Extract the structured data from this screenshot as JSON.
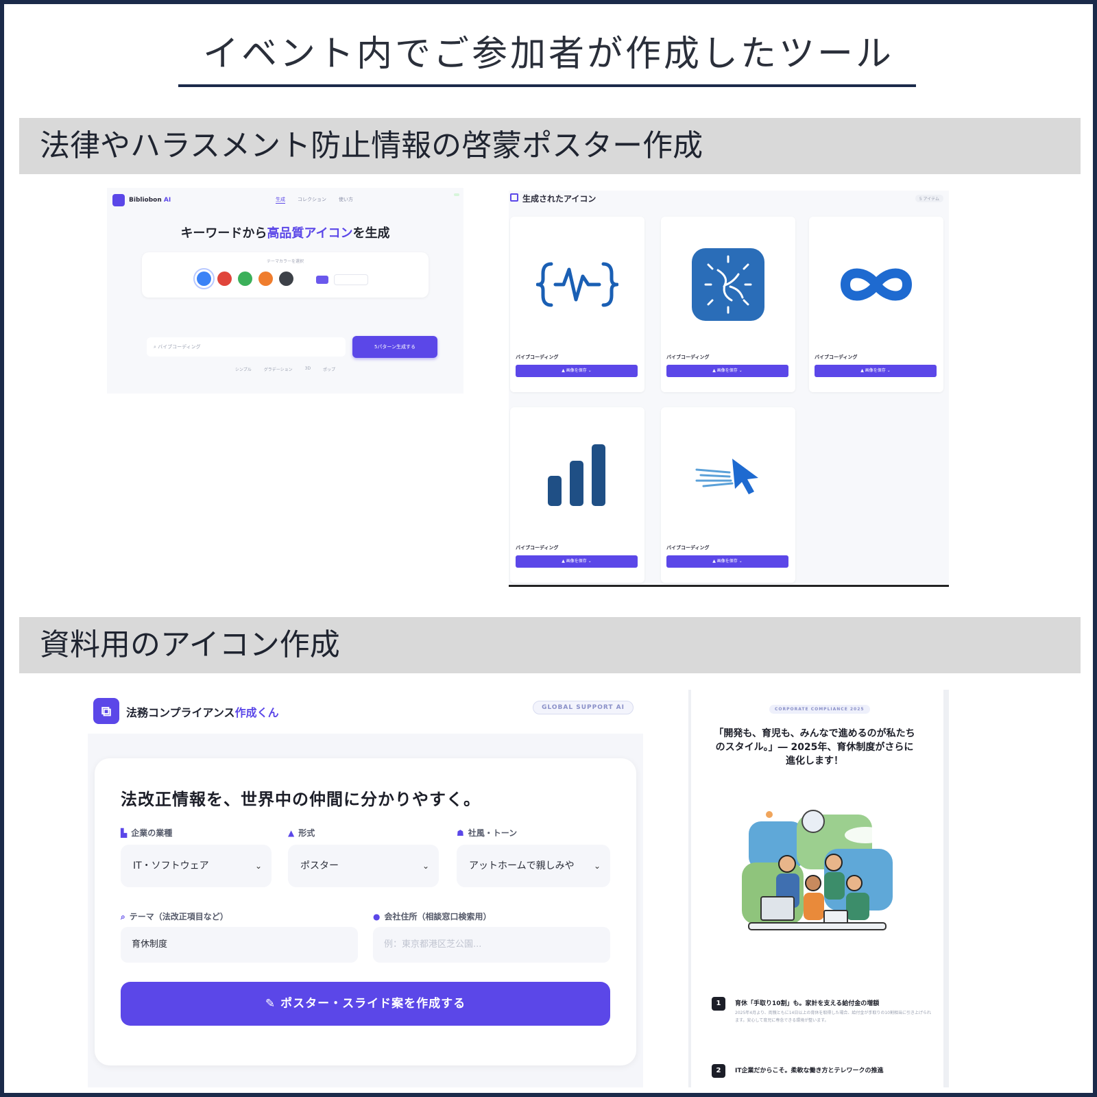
{
  "page": {
    "title": "イベント内でご参加者が作成したツール",
    "section1": "法律やハラスメント防止情報の啓蒙ポスター作成",
    "section2": "資料用のアイコン作成"
  },
  "icon_generator": {
    "brand": "Bibliobon",
    "brand_ai": "AI",
    "nav": [
      "生成",
      "コレクション",
      "使い方"
    ],
    "heading_pre": "キーワードから",
    "heading_highlight": "高品質アイコン",
    "heading_post": "を生成",
    "theme_color_label": "テーマカラーを選択",
    "colors": [
      "#3b82f6",
      "#e0453b",
      "#3bb05a",
      "#ef7d2e",
      "#3d4148"
    ],
    "search_value": "バイブコーディング",
    "generate_button": "5パターン生成する",
    "style_tags": [
      "シンプル",
      "グラデーション",
      "3D",
      "ポップ"
    ]
  },
  "icon_results": {
    "title": "生成されたアイコン",
    "count": "5 アイテム",
    "download_label": "画像を保存",
    "items": [
      {
        "label": "バイブコーディング",
        "icon": "code-wave-icon"
      },
      {
        "label": "バイブコーディング",
        "icon": "sparkle-app-icon"
      },
      {
        "label": "バイブコーディング",
        "icon": "infinity-icon"
      },
      {
        "label": "バイブコーディング",
        "icon": "bar-chart-icon"
      },
      {
        "label": "バイブコーディング",
        "icon": "fast-cursor-icon"
      }
    ]
  },
  "compliance_form": {
    "brand_pre": "法務コンプライアンス",
    "brand_highlight": "作成くん",
    "tag": "GLOBAL SUPPORT AI",
    "heading": "法改正情報を、世界中の仲間に分かりやすく。",
    "industry_label": "企業の業種",
    "industry_value": "IT・ソフトウェア",
    "format_label": "形式",
    "format_value": "ポスター",
    "tone_label": "社風・トーン",
    "tone_value": "アットホームで親しみや",
    "theme_label": "テーマ（法改正項目など）",
    "theme_value": "育休制度",
    "address_label": "会社住所（相談窓口検索用）",
    "address_placeholder": "例：東京都港区芝公園...",
    "submit": "ポスター・スライド案を作成する"
  },
  "poster": {
    "pill": "CORPORATE COMPLIANCE 2025",
    "headline": "「開発も、育児も、みんなで進めるのが私たちのスタイル。」― 2025年、育休制度がさらに進化します！",
    "items": [
      {
        "num": "1",
        "title": "育休「手取り10割」も。家計を支える給付金の増額",
        "body": "2025年4月より、両親ともに14日以上の育休を取得した場合、給付金が手取りの10割相当に引き上げられます。安心して育児に専念できる環境が整います。"
      },
      {
        "num": "2",
        "title": "IT企業だからこそ。柔軟な働き方とテレワークの推進",
        "body": ""
      }
    ]
  }
}
